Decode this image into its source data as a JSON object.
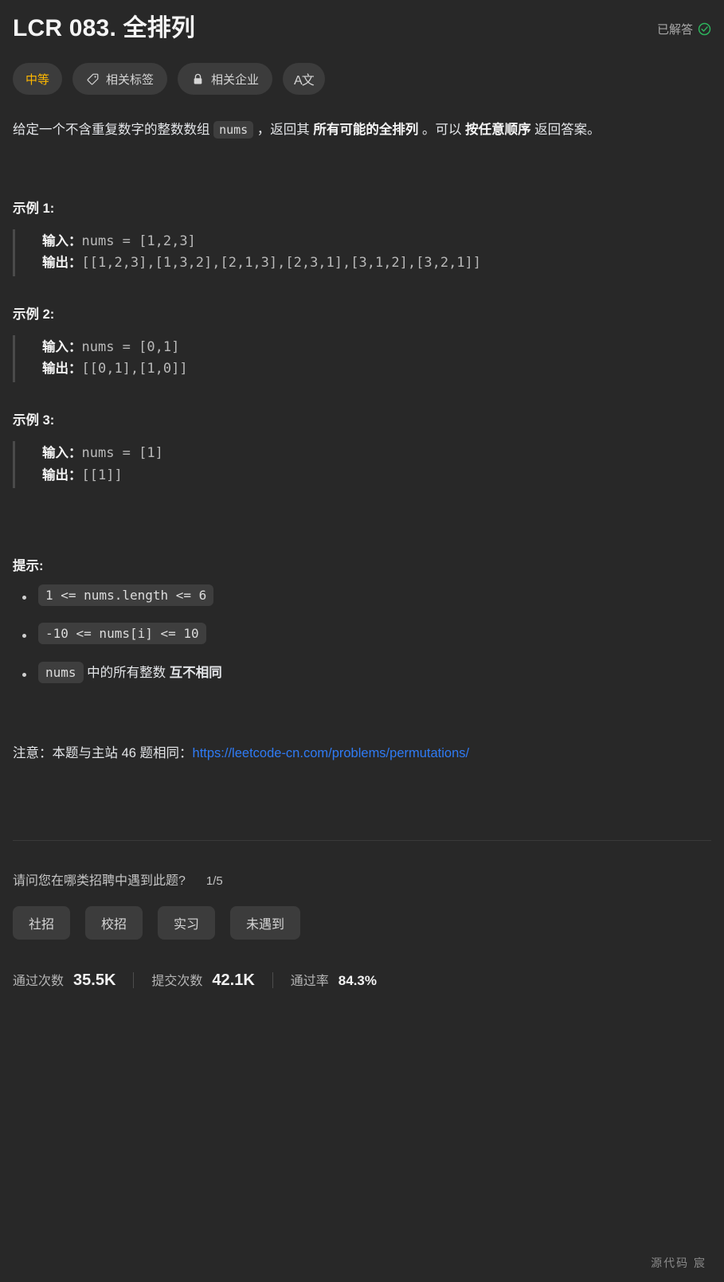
{
  "header": {
    "title": "LCR 083. 全排列",
    "status_label": "已解答",
    "status_icon": "check-circle-icon",
    "status_color": "#2db55d"
  },
  "tags": {
    "difficulty": {
      "label": "中等",
      "color": "#ffb800"
    },
    "topics": {
      "label": "相关标签",
      "icon": "tag-icon"
    },
    "companies": {
      "label": "相关企业",
      "icon": "lock-icon"
    },
    "translate": {
      "label": "A文",
      "icon": "translate-icon"
    }
  },
  "description": {
    "part1": "给定一个不含重复数字的整数数组 ",
    "code1": "nums",
    "part2": " ，返回其 ",
    "bold1": "所有可能的全排列",
    "part3": " 。可以 ",
    "bold2": "按任意顺序",
    "part4": " 返回答案。"
  },
  "examples": [
    {
      "title": "示例 1:",
      "input_label": "输入：",
      "input_value": "nums = [1,2,3]",
      "output_label": "输出：",
      "output_value": "[[1,2,3],[1,3,2],[2,1,3],[2,3,1],[3,1,2],[3,2,1]]"
    },
    {
      "title": "示例 2:",
      "input_label": "输入：",
      "input_value": "nums = [0,1]",
      "output_label": "输出：",
      "output_value": "[[0,1],[1,0]]"
    },
    {
      "title": "示例 3:",
      "input_label": "输入：",
      "input_value": "nums = [1]",
      "output_label": "输出：",
      "output_value": "[[1]]"
    }
  ],
  "hints": {
    "title": "提示:",
    "items": [
      {
        "code": "1 <= nums.length <= 6",
        "text": ""
      },
      {
        "code": "-10 <= nums[i] <= 10",
        "text": ""
      },
      {
        "code": "nums",
        "text": " 中的所有整数 ",
        "bold": "互不相同"
      }
    ]
  },
  "note": {
    "prefix": "注意：本题与主站 46 题相同：",
    "link_text": "https://leetcode-cn.com/problems/permutations/",
    "link_color": "#2f7bf5"
  },
  "survey": {
    "question": "请问您在哪类招聘中遇到此题?",
    "progress": "1/5",
    "options": [
      "社招",
      "校招",
      "实习",
      "未遇到"
    ]
  },
  "stats": [
    {
      "label": "通过次数",
      "value": "35.5K"
    },
    {
      "label": "提交次数",
      "value": "42.1K"
    },
    {
      "label": "通过率",
      "value": "84.3%"
    }
  ],
  "watermark": "源代码  宸"
}
